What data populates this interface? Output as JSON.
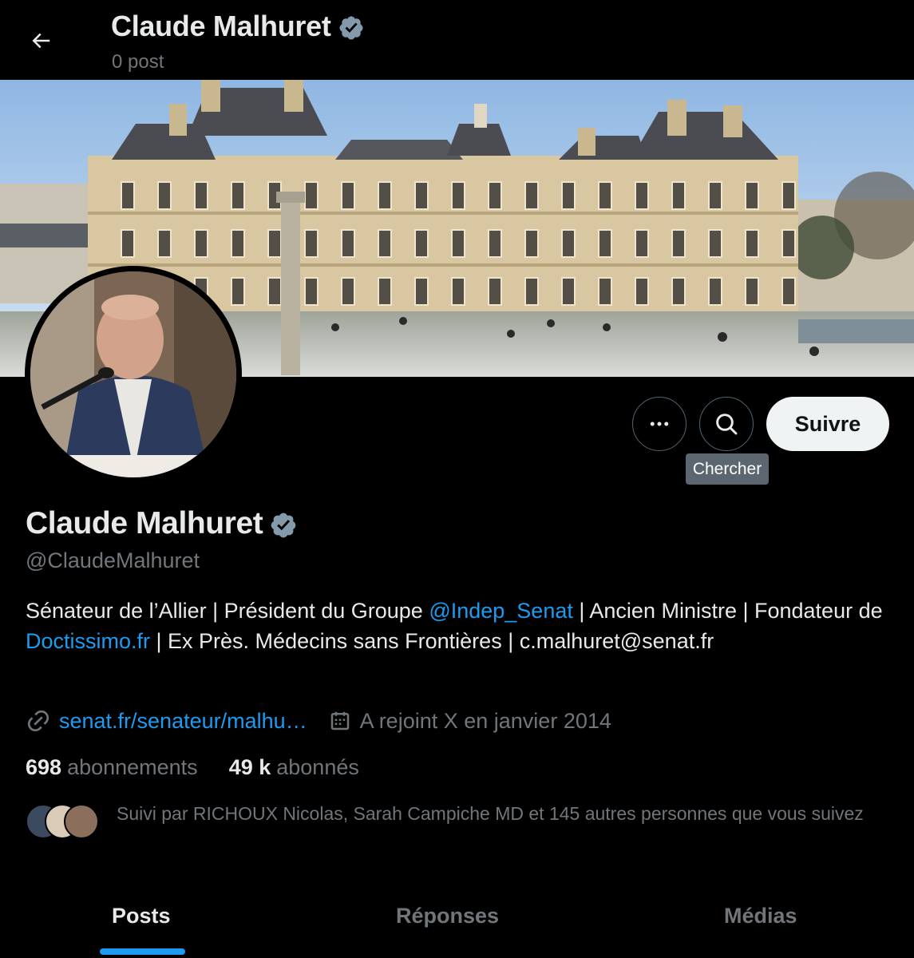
{
  "header": {
    "name": "Claude Malhuret",
    "post_count": "0 post"
  },
  "actions": {
    "follow_label": "Suivre",
    "search_tooltip": "Chercher"
  },
  "profile": {
    "name": "Claude Malhuret",
    "handle": "@ClaudeMalhuret",
    "bio": {
      "part1": "Sénateur de l’Allier | Président du Groupe ",
      "mention": "@Indep_Senat",
      "part2": " | Ancien Ministre | Fondateur de ",
      "site": "Doctissimo.fr",
      "part3": " | Ex Près. Médecins sans Frontières | c.malhuret@senat.fr"
    },
    "website": "senat.fr/senateur/malhu…",
    "joined": "A rejoint X en janvier 2014"
  },
  "stats": {
    "following_count": "698",
    "following_label": "abonnements",
    "followers_count": "49 k",
    "followers_label": "abonnés"
  },
  "followed_by": "Suivi par RICHOUX Nicolas, Sarah Campiche MD et 145 autres personnes que vous suivez",
  "tabs": [
    {
      "label": "Posts"
    },
    {
      "label": "Réponses"
    },
    {
      "label": "Médias"
    }
  ],
  "colors": {
    "accent": "#1d9bf0",
    "verified": "#829aab",
    "muted": "#71767b"
  },
  "icons": [
    "back-arrow-icon",
    "verified-badge-icon",
    "more-icon",
    "search-icon",
    "link-icon",
    "calendar-icon"
  ]
}
